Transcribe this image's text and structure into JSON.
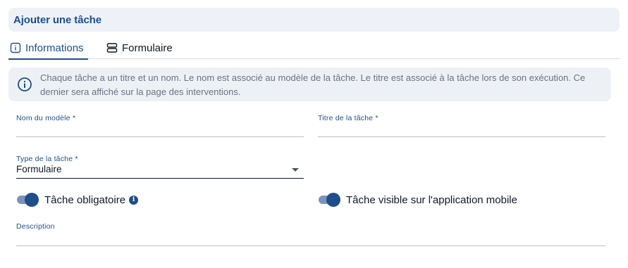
{
  "header": {
    "title": "Ajouter une tâche"
  },
  "tabs": [
    {
      "label": "Informations",
      "icon": "info-icon",
      "active": true
    },
    {
      "label": "Formulaire",
      "icon": "form-layout-icon",
      "active": false
    }
  ],
  "alert": {
    "icon": "info-icon",
    "text": "Chaque tâche a un titre et un nom. Le nom est associé au modèle de la tâche. Le titre est associé à la tâche lors de son exécution. Ce dernier sera affiché sur la page des interventions."
  },
  "form": {
    "model_name": {
      "label": "Nom du modèle *",
      "value": ""
    },
    "task_title": {
      "label": "Titre de la tâche *",
      "value": ""
    },
    "task_type": {
      "label": "Type de la tâche *",
      "value": "Formulaire"
    },
    "mandatory": {
      "label": "Tâche obligatoire",
      "on": true,
      "info_icon": "i"
    },
    "mobile_visible": {
      "label": "Tâche visible sur l'application mobile",
      "on": true
    },
    "description": {
      "label": "Description",
      "value": ""
    }
  },
  "colors": {
    "primary": "#1e4e8c",
    "header_bg": "#eef2f7",
    "alert_bg": "#edf1f6",
    "switch_track": "#7b93bc"
  }
}
